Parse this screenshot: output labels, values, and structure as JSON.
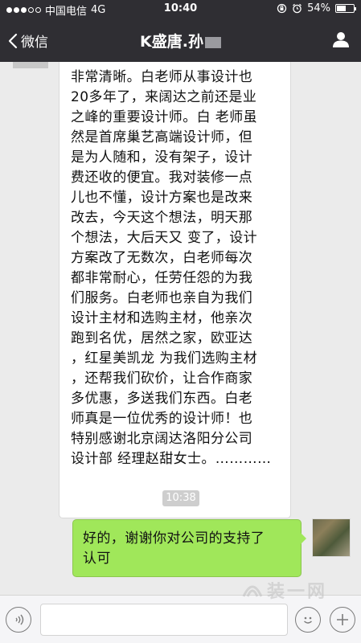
{
  "status_bar": {
    "carrier": "中国电信",
    "network": "4G",
    "time": "10:40",
    "battery": "54%",
    "battery_level": 0.54,
    "signal_bars_filled": 3,
    "signal_bars_total": 5
  },
  "nav": {
    "back_label": "微信",
    "title": "K盛唐.孙"
  },
  "messages": {
    "incoming_text": "非常清晰。白老师从事设计也\n20多年了，来阔达之前还是业\n之峰的重要设计师。白 老师虽\n然是首席巢艺高端设计师，但\n是为人随和，没有架子，设计\n费还收的便宜。我对装修一点\n儿也不懂，设计方案也是改来\n改去，今天这个想法，明天那\n个想法，大后天又 变了，设计\n方案改了无数次，白老师每次\n都非常耐心，任劳任怨的为我\n们服务。白老师也亲自为我们\n设计主材和选购主材，他亲次\n跑到名优，居然之家，欧亚达\n，红星美凯龙 为我们选购主材\n，还帮我们砍价，让合作商家\n多优惠，多送我们东西。白老\n师真是一位优秀的设计师！也\n特别感谢北京阔达洛阳分公司\n设计部 经理赵甜女士。…………",
    "timestamp": "10:38",
    "outgoing_text": "好的，谢谢你对公司的支持了\n认可"
  },
  "watermark": {
    "text": "装一网"
  },
  "colors": {
    "header_bg": "#2f2e33",
    "chat_bg": "#ebebeb",
    "outgoing_bubble": "#a0e75a",
    "incoming_bubble": "#ffffff"
  },
  "icons": {
    "back": "chevron-left-icon",
    "profile": "person-icon",
    "voice": "voice-icon",
    "emoji": "emoji-icon",
    "plus": "plus-icon"
  }
}
